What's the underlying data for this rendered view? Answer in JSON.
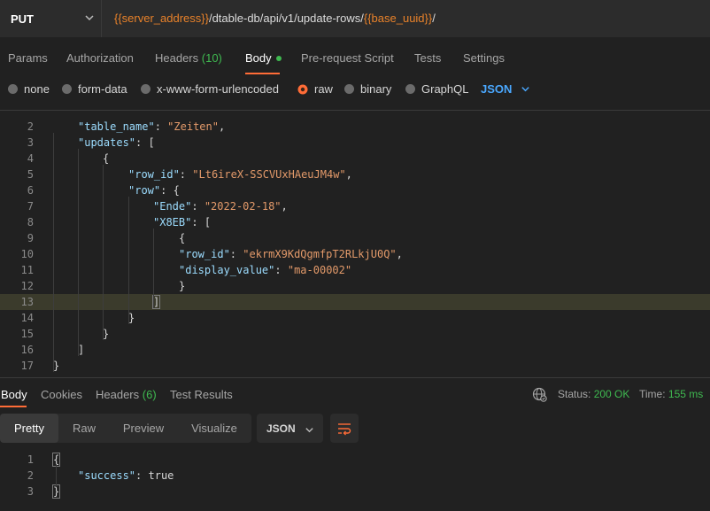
{
  "request": {
    "method": "PUT",
    "url_parts": [
      {
        "text": "{{server_address}}",
        "type": "var"
      },
      {
        "text": "/dtable-db/api/v1/update-rows/",
        "type": "plain"
      },
      {
        "text": "{{base_uuid}}",
        "type": "var"
      },
      {
        "text": "/",
        "type": "plain"
      }
    ]
  },
  "request_tabs": {
    "params": "Params",
    "authorization": "Authorization",
    "headers": "Headers",
    "headers_count": "(10)",
    "body": "Body",
    "pre_request": "Pre-request Script",
    "tests": "Tests",
    "settings": "Settings"
  },
  "body_types": {
    "none": "none",
    "form_data": "form-data",
    "urlencoded": "x-www-form-urlencoded",
    "raw": "raw",
    "binary": "binary",
    "graphql": "GraphQL",
    "selected": "raw",
    "format": "JSON"
  },
  "editor": {
    "lines": [
      {
        "n": "2",
        "text": "\"table_name\": \"Zeiten\","
      },
      {
        "n": "3",
        "text": "\"updates\": ["
      },
      {
        "n": "4",
        "text": "{"
      },
      {
        "n": "5",
        "text": "\"row_id\": \"Lt6ireX-SSCVUxHAeuJM4w\","
      },
      {
        "n": "6",
        "text": "\"row\": {"
      },
      {
        "n": "7",
        "text": "\"Ende\": \"2022-02-18\","
      },
      {
        "n": "8",
        "text": "\"X8EB\": ["
      },
      {
        "n": "9",
        "text": "{"
      },
      {
        "n": "10",
        "text": "\"row_id\": \"ekrmX9KdQgmfpT2RLkjU0Q\","
      },
      {
        "n": "11",
        "text": "\"display_value\": \"ma-00002\""
      },
      {
        "n": "12",
        "text": "}"
      },
      {
        "n": "13",
        "text": "]"
      },
      {
        "n": "14",
        "text": "}"
      },
      {
        "n": "15",
        "text": "}"
      },
      {
        "n": "16",
        "text": "]"
      },
      {
        "n": "17",
        "text": "}"
      }
    ],
    "highlighted_line": "13"
  },
  "response_tabs": {
    "body": "Body",
    "cookies": "Cookies",
    "headers": "Headers",
    "headers_count": "(6)",
    "test_results": "Test Results"
  },
  "response_status": {
    "status_label": "Status:",
    "status_value": "200 OK",
    "time_label": "Time:",
    "time_value": "155 ms"
  },
  "response_view": {
    "pretty": "Pretty",
    "raw": "Raw",
    "preview": "Preview",
    "visualize": "Visualize",
    "format": "JSON"
  },
  "response_body": {
    "lines": [
      {
        "n": "1",
        "text": "{"
      },
      {
        "n": "2",
        "text": "\"success\": true"
      },
      {
        "n": "3",
        "text": "}"
      }
    ]
  },
  "colors": {
    "accent": "#ff6c37",
    "variable": "#e9822a",
    "success": "#3fb950",
    "link": "#4aa8ff"
  }
}
